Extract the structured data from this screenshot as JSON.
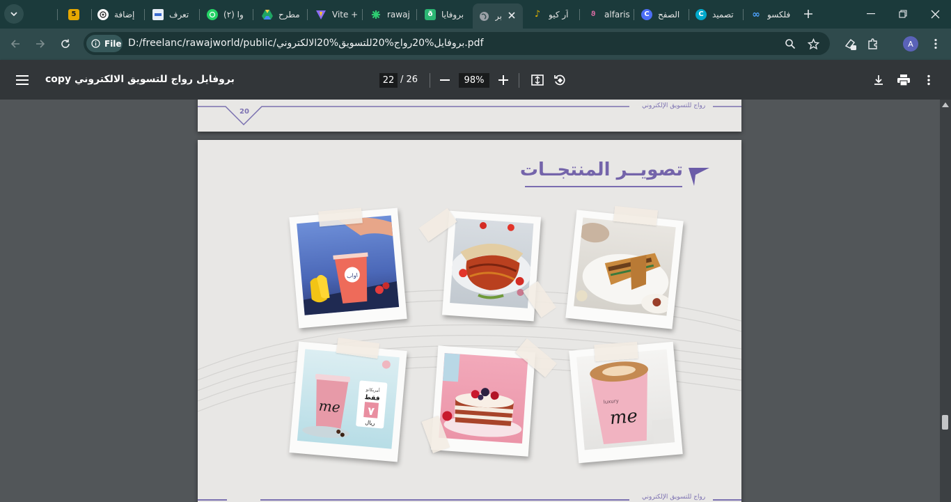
{
  "browser": {
    "tabs": [
      {
        "title": "",
        "favicon_text": "5",
        "favicon_color": "#e6a800"
      },
      {
        "title": "إضافة",
        "favicon_text": "",
        "favicon_color": "#ffffff"
      },
      {
        "title": "تعرف",
        "favicon_text": "",
        "favicon_color": "#e8eef8"
      },
      {
        "title": "(٢) وا",
        "favicon_text": "",
        "favicon_color": "#25d366"
      },
      {
        "title": "مطرح",
        "favicon_text": "",
        "favicon_color": "#1fa463"
      },
      {
        "title": "Vite +",
        "favicon_text": "",
        "favicon_color": "#8c6cf5"
      },
      {
        "title": "rawaj",
        "favicon_text": "",
        "favicon_color": "#2ecc71"
      },
      {
        "title": "بروفايا",
        "favicon_text": "",
        "favicon_color": "#2bb673"
      },
      {
        "title": "بر",
        "favicon_text": "",
        "favicon_color": "#9aa0a6",
        "active": true
      },
      {
        "title": "آر كيو",
        "favicon_text": "",
        "favicon_color": "#e0b400"
      },
      {
        "title": "alfaris",
        "favicon_text": "",
        "favicon_color": "#b45a8c"
      },
      {
        "title": "الصفح",
        "favicon_text": "",
        "favicon_color": "#4c6ef5"
      },
      {
        "title": "تصميد",
        "favicon_text": "",
        "favicon_color": "#00c4cc"
      },
      {
        "title": "فلكسو",
        "favicon_text": "",
        "favicon_color": "#4ea3ff"
      }
    ],
    "omnibox": {
      "chip_label": "File",
      "url": "D:/freelanc/rawajworld/public/بروفايل%20رواج%20للتسويق%20الالكتروني.pdf"
    },
    "profile_initial": "A"
  },
  "pdf_viewer": {
    "title": "copy بروفايل رواج للتسويق الالكتروني",
    "current_page": "22",
    "total_pages": "/ 26",
    "zoom": "98%"
  },
  "document": {
    "prev_page_number": "20",
    "footer_text": "رواج للتسويق الإلكتروني",
    "section_title": "تصويــر المنتجــات",
    "accent_color": "#7464aa",
    "photos": [
      {
        "name": "juice-cup-photo"
      },
      {
        "name": "grilled-skewers-photo"
      },
      {
        "name": "wraps-plate-photo"
      },
      {
        "name": "coffee-cup-promo-photo",
        "badge_line1": "أمريكانو",
        "badge_line2": "فقط",
        "badge_price": "٧",
        "badge_currency": "ريال",
        "cup_text": "me"
      },
      {
        "name": "berry-cake-photo"
      },
      {
        "name": "latte-cup-photo",
        "cup_text": "me",
        "cup_subtext": "luxury"
      }
    ],
    "juice_brand": "اواب"
  }
}
